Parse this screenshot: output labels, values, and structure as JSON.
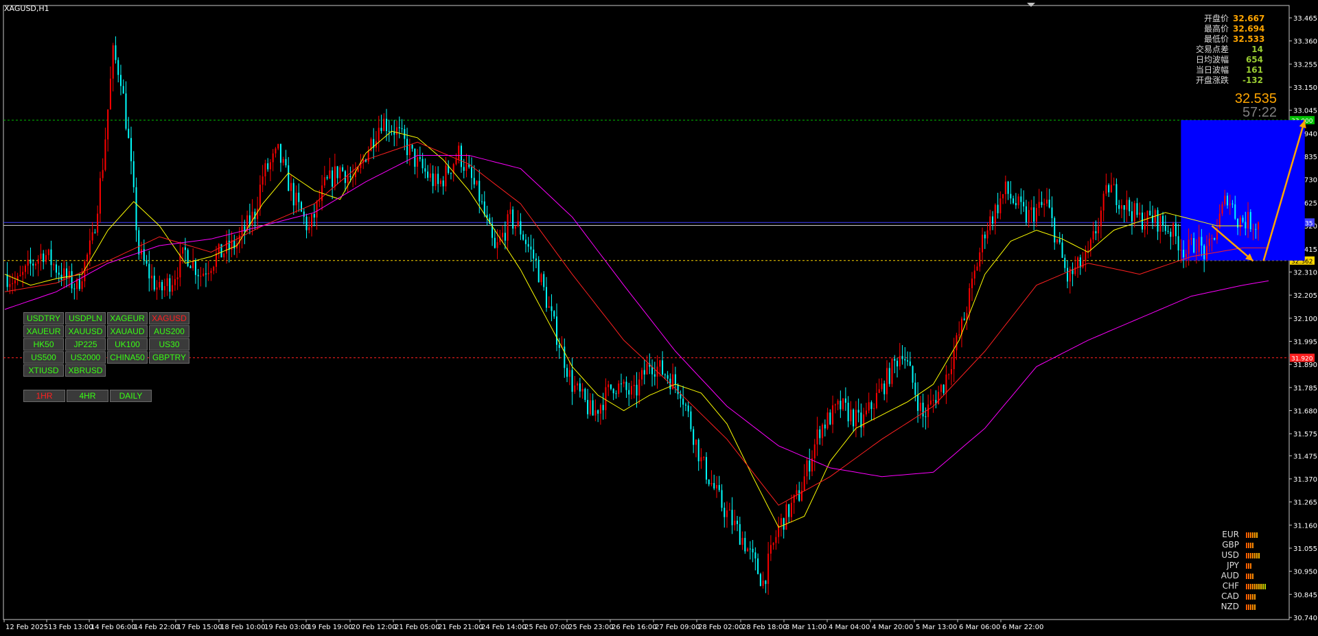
{
  "window": {
    "title": "XAGUSD,H1"
  },
  "info_panel": [
    {
      "label": "开盘价",
      "value": "32.667"
    },
    {
      "label": "最高价",
      "value": "32.694"
    },
    {
      "label": "最低价",
      "value": "32.533"
    },
    {
      "label": "交易点差",
      "value": "14"
    },
    {
      "label": "日均波幅",
      "value": "654"
    },
    {
      "label": "当日波幅",
      "value": "161"
    },
    {
      "label": "开盘涨跌",
      "value": "-132"
    }
  ],
  "current_price": "32.535",
  "bar_timer": "57:22",
  "symbol_buttons": [
    {
      "label": "USDTRY",
      "active": false
    },
    {
      "label": "USDPLN",
      "active": false
    },
    {
      "label": "XAGEUR",
      "active": false
    },
    {
      "label": "XAGUSD",
      "active": true
    },
    {
      "label": "XAUEUR",
      "active": false
    },
    {
      "label": "XAUUSD",
      "active": false
    },
    {
      "label": "XAUAUD",
      "active": false
    },
    {
      "label": "AUS200",
      "active": false
    },
    {
      "label": "HK50",
      "active": false
    },
    {
      "label": "JP225",
      "active": false
    },
    {
      "label": "UK100",
      "active": false
    },
    {
      "label": "US30",
      "active": false
    },
    {
      "label": "US500",
      "active": false
    },
    {
      "label": "US2000",
      "active": false
    },
    {
      "label": "CHINA50",
      "active": false
    },
    {
      "label": "GBPTRY",
      "active": false
    },
    {
      "label": "XTIUSD",
      "active": false
    },
    {
      "label": "XBRUSD",
      "active": false
    }
  ],
  "timeframe_buttons": [
    {
      "label": "1HR",
      "active": true
    },
    {
      "label": "4HR",
      "active": false
    },
    {
      "label": "DAILY",
      "active": false
    }
  ],
  "currency_strength": [
    {
      "name": "EUR",
      "level": 6
    },
    {
      "name": "GBP",
      "level": 4
    },
    {
      "name": "USD",
      "level": 7
    },
    {
      "name": "JPY",
      "level": 3
    },
    {
      "name": "AUD",
      "level": 4
    },
    {
      "name": "CHF",
      "level": 10
    },
    {
      "name": "CAD",
      "level": 5
    },
    {
      "name": "NZD",
      "level": 5
    }
  ],
  "colors": {
    "bull": "#ff0000",
    "bear": "#00ffff",
    "ma_fast": "#ffff00",
    "ma_mid": "#ff2020",
    "ma_slow": "#ff00ff",
    "zone": "#0000ff",
    "arrow": "#ffa500"
  },
  "chart_data": {
    "type": "candlestick",
    "symbol": "XAGUSD",
    "timeframe": "H1",
    "ylim": [
      30.74,
      33.465
    ],
    "y_ticks": [
      "33.465",
      "33.360",
      "33.255",
      "33.150",
      "33.045",
      "32.940",
      "32.835",
      "32.730",
      "32.625",
      "32.520",
      "32.415",
      "32.310",
      "32.205",
      "32.100",
      "31.995",
      "31.890",
      "31.785",
      "31.680",
      "31.575",
      "31.475",
      "31.370",
      "31.265",
      "31.160",
      "31.055",
      "30.950",
      "30.845",
      "30.740"
    ],
    "x_labels": [
      "12 Feb 2025",
      "13 Feb 13:00",
      "14 Feb 06:00",
      "14 Feb 22:00",
      "17 Feb 15:00",
      "18 Feb 10:00",
      "19 Feb 03:00",
      "19 Feb 19:00",
      "20 Feb 12:00",
      "21 Feb 05:00",
      "21 Feb 21:00",
      "24 Feb 14:00",
      "25 Feb 07:00",
      "25 Feb 23:00",
      "26 Feb 16:00",
      "27 Feb 09:00",
      "28 Feb 02:00",
      "28 Feb 18:00",
      "3 Mar 11:00",
      "4 Mar 04:00",
      "4 Mar 20:00",
      "5 Mar 13:00",
      "6 Mar 06:00",
      "6 Mar 22:00"
    ],
    "horizontal_lines": [
      {
        "price": 33.0,
        "label": "33.000",
        "color": "#00c000"
      },
      {
        "price": 32.535,
        "label": "32.535",
        "color": "#4040ff"
      },
      {
        "price": 32.362,
        "label": "32.362",
        "color": "#ffd700"
      },
      {
        "price": 31.92,
        "label": "31.920",
        "color": "#ff2020"
      }
    ],
    "path_series": {
      "name": "close",
      "x": [
        0,
        5,
        10,
        15,
        22,
        28,
        34,
        38,
        42,
        45,
        48,
        52,
        56,
        60,
        65,
        70,
        76,
        82,
        90,
        97,
        100,
        106,
        112,
        118,
        124,
        130,
        136,
        140,
        146,
        152,
        160,
        168,
        176,
        184,
        190,
        196,
        200,
        206,
        212,
        220,
        228,
        236,
        244,
        250,
        256,
        262,
        270,
        278,
        286,
        294,
        300,
        308,
        316,
        324,
        332,
        340,
        348,
        356,
        364,
        372,
        380,
        388,
        396,
        404,
        412,
        420,
        428,
        434,
        440,
        446,
        452,
        458,
        462,
        466,
        470,
        474,
        478,
        486
      ],
      "y": [
        32.3,
        32.26,
        32.34,
        32.4,
        32.3,
        32.24,
        32.45,
        32.8,
        33.3,
        33.2,
        32.9,
        32.4,
        32.3,
        32.22,
        32.28,
        32.4,
        32.3,
        32.38,
        32.44,
        32.58,
        32.75,
        32.85,
        32.65,
        32.5,
        32.7,
        32.78,
        32.72,
        32.85,
        33.0,
        32.95,
        32.8,
        32.7,
        32.85,
        32.65,
        32.4,
        32.55,
        32.5,
        32.35,
        32.1,
        31.8,
        31.66,
        31.8,
        31.75,
        31.9,
        31.85,
        31.78,
        31.45,
        31.25,
        31.1,
        30.9,
        31.15,
        31.3,
        31.6,
        31.7,
        31.62,
        31.78,
        31.96,
        31.65,
        31.8,
        32.1,
        32.5,
        32.68,
        32.56,
        32.62,
        32.28,
        32.38,
        32.7,
        32.62,
        32.55,
        32.55,
        32.5,
        32.4,
        32.45,
        32.38,
        32.52,
        32.66,
        32.55,
        32.53
      ]
    },
    "moving_averages": [
      {
        "name": "MA fast",
        "color": "#ffff00",
        "x": [
          0,
          10,
          20,
          30,
          40,
          50,
          60,
          70,
          80,
          90,
          100,
          110,
          120,
          130,
          140,
          150,
          160,
          170,
          180,
          190,
          200,
          210,
          220,
          230,
          240,
          250,
          260,
          270,
          280,
          290,
          300,
          310,
          320,
          330,
          340,
          350,
          360,
          370,
          380,
          390,
          400,
          410,
          420,
          430,
          440,
          450,
          460,
          470,
          480
        ],
        "y": [
          32.3,
          32.25,
          32.28,
          32.3,
          32.5,
          32.63,
          32.52,
          32.35,
          32.38,
          32.43,
          32.62,
          32.76,
          32.68,
          32.64,
          32.85,
          32.95,
          32.92,
          32.82,
          32.68,
          32.5,
          32.32,
          32.1,
          31.88,
          31.75,
          31.68,
          31.75,
          31.8,
          31.76,
          31.62,
          31.38,
          31.15,
          31.2,
          31.45,
          31.6,
          31.66,
          31.72,
          31.8,
          32.0,
          32.3,
          32.45,
          32.5,
          32.46,
          32.4,
          32.5,
          32.54,
          32.58,
          32.55,
          32.52,
          32.52
        ]
      },
      {
        "name": "MA mid",
        "color": "#ff2020",
        "x": [
          0,
          20,
          40,
          60,
          80,
          100,
          120,
          140,
          160,
          180,
          200,
          220,
          240,
          260,
          280,
          300,
          320,
          340,
          360,
          380,
          400,
          420,
          440,
          460,
          480,
          490
        ],
        "y": [
          32.22,
          32.26,
          32.36,
          32.47,
          32.4,
          32.52,
          32.62,
          32.82,
          32.9,
          32.8,
          32.62,
          32.3,
          32.0,
          31.78,
          31.55,
          31.25,
          31.38,
          31.55,
          31.7,
          31.95,
          32.25,
          32.35,
          32.3,
          32.38,
          32.42,
          32.42
        ]
      },
      {
        "name": "MA slow",
        "color": "#ff00ff",
        "x": [
          0,
          20,
          40,
          60,
          80,
          100,
          120,
          140,
          160,
          180,
          200,
          220,
          240,
          260,
          280,
          300,
          320,
          340,
          360,
          380,
          400,
          420,
          440,
          460,
          480,
          490
        ],
        "y": [
          32.14,
          32.22,
          32.35,
          32.43,
          32.46,
          32.52,
          32.58,
          32.72,
          32.84,
          32.84,
          32.78,
          32.56,
          32.25,
          31.95,
          31.7,
          31.52,
          31.42,
          31.38,
          31.4,
          31.6,
          31.88,
          32.0,
          32.1,
          32.2,
          32.25,
          32.27
        ]
      }
    ],
    "annotation_zone": {
      "x_from": 456,
      "x_to": 504,
      "price_top": 33.0,
      "price_bottom": 32.362
    },
    "arrows": [
      {
        "x_from": 468,
        "price_from": 32.52,
        "x_to": 484,
        "price_to": 32.36
      },
      {
        "x_from": 488,
        "price_from": 32.36,
        "x_to": 504,
        "price_to": 33.0
      }
    ]
  }
}
